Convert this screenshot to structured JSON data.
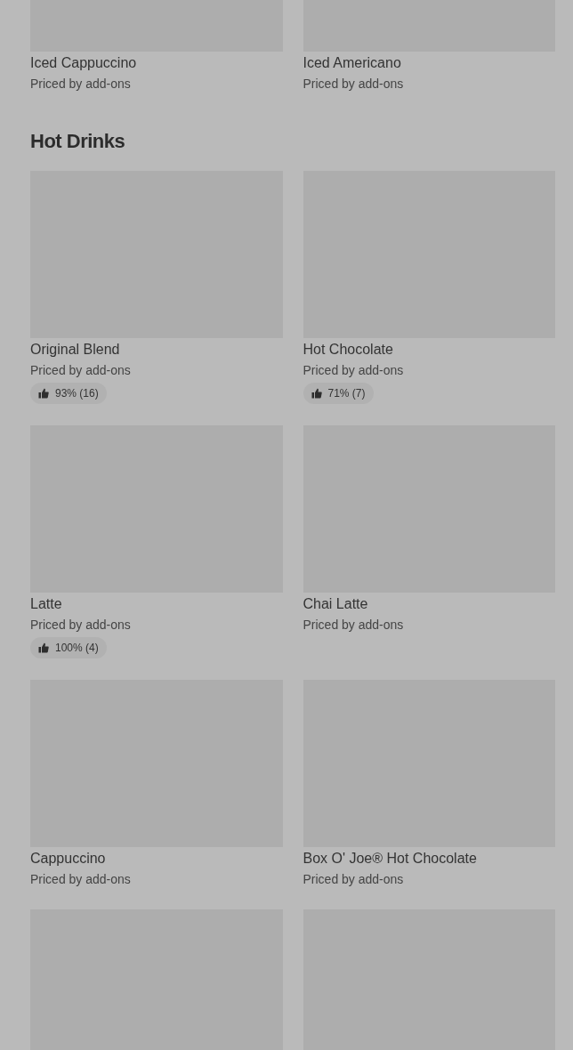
{
  "sections": [
    {
      "items": [
        {
          "kind": "cut_top",
          "name": "Iced Cappuccino",
          "price": "Priced by add-ons"
        },
        {
          "kind": "cut_top",
          "name": "Iced Americano",
          "price": "Priced by add-ons"
        }
      ]
    },
    {
      "title": "Hot Drinks",
      "items": [
        {
          "kind": "full",
          "name": "Original Blend",
          "price": "Priced by add-ons",
          "rating": "93% (16)"
        },
        {
          "kind": "full",
          "name": "Hot Chocolate",
          "price": "Priced by add-ons",
          "rating": "71% (7)"
        },
        {
          "kind": "full",
          "name": "Latte",
          "price": "Priced by add-ons",
          "rating": "100% (4)"
        },
        {
          "kind": "full",
          "name": "Chai Latte",
          "price": "Priced by add-ons"
        },
        {
          "kind": "full",
          "name": "Cappuccino",
          "price": "Priced by add-ons"
        },
        {
          "kind": "full",
          "name": "Box O' Joe® Hot Chocolate",
          "price": "Priced by add-ons"
        },
        {
          "kind": "cut_bottom"
        },
        {
          "kind": "cut_bottom"
        }
      ]
    }
  ]
}
